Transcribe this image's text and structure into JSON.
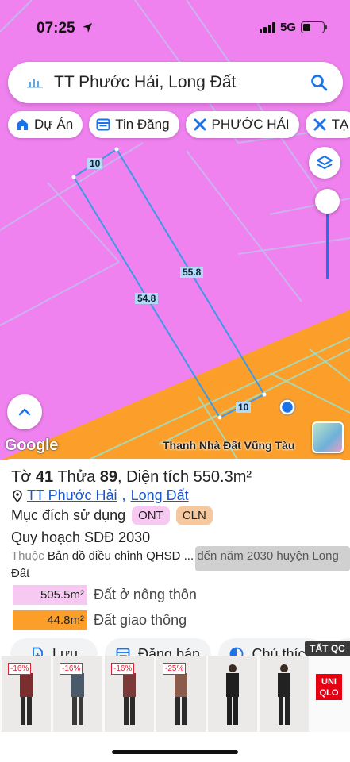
{
  "status_bar": {
    "time": "07:25",
    "network": "5G",
    "battery_level": 0.35
  },
  "search": {
    "text": "TT Phước Hải, Long Đất"
  },
  "chips": [
    {
      "label": "Dự Án",
      "icon": "home-icon"
    },
    {
      "label": "Tin Đăng",
      "icon": "listing-icon"
    },
    {
      "label": "PHƯỚC HẢI",
      "icon": "zone-icon"
    },
    {
      "label": "TẠ",
      "icon": "zone-icon"
    }
  ],
  "map": {
    "measurements": {
      "top": "10",
      "left": "54.8",
      "right": "55.8",
      "bottom": "10"
    },
    "google_label": "Google",
    "brand_label": "Thanh Nhà Đất Vũng Tàu",
    "colors": {
      "residential": "#ef82ef",
      "road": "#fb9f2a",
      "parcel_line": "#3b9ae8"
    }
  },
  "panel": {
    "sheet_label": "Tờ",
    "sheet_no": "41",
    "lot_label": "Thửa",
    "lot_no": "89",
    "area_label": ", Diện tích",
    "area_value": "550.3m²",
    "location_town": "TT Phước Hải",
    "location_district": "Long Đất",
    "purpose_label": "Mục đích sử dụng",
    "tags": [
      "ONT",
      "CLN"
    ],
    "plan_label": "Quy hoạch SDĐ 2030",
    "source_prefix": "Thuộc",
    "source_text": "Bản đồ điều chỉnh QHSD ... đến năm 2030 huyện Long Đất",
    "legend": [
      {
        "value": "505.5m²",
        "label": "Đất ở nông thôn",
        "color": "#f7c9f2",
        "fraction": 0.92
      },
      {
        "value": "44.8m²",
        "label": "Đất giao thông",
        "color": "#fb9f2a",
        "fraction": 0.08
      }
    ],
    "actions": [
      {
        "label": "Lưu",
        "icon": "save-icon"
      },
      {
        "label": "Đăng bán",
        "icon": "post-icon"
      },
      {
        "label": "Chú thích",
        "icon": "legend-icon"
      }
    ]
  },
  "ad": {
    "label": "TẤT QC",
    "discounts": [
      "-16%",
      "-16%",
      "-16%",
      "-25%"
    ],
    "brand": "UNI QLO"
  }
}
